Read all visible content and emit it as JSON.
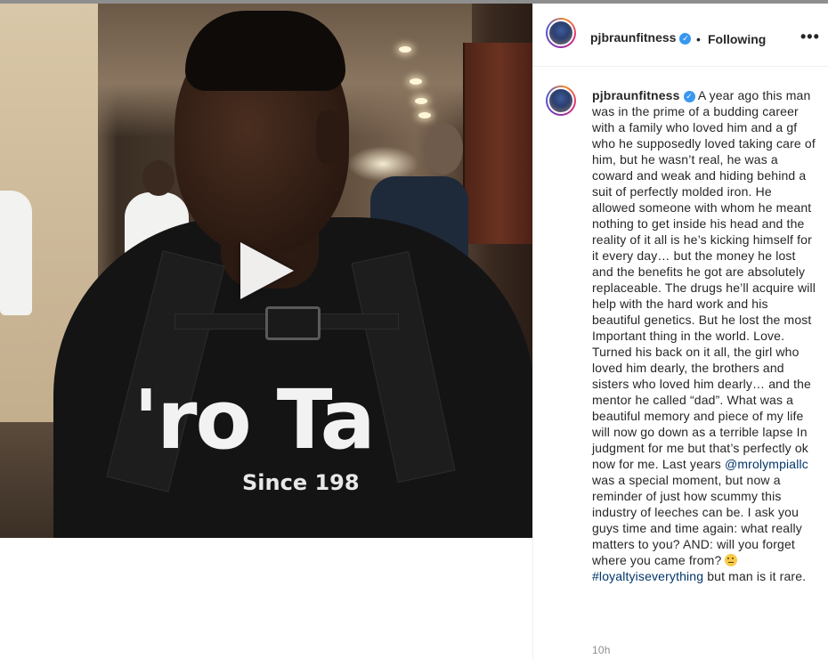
{
  "post": {
    "username": "pjbraunfitness",
    "verified": true,
    "follow_separator": "•",
    "follow_status": "Following",
    "more_options": "•••",
    "timestamp": "10h"
  },
  "caption": {
    "username": "pjbraunfitness",
    "text_1": "A year ago this man was in the prime of a budding career with a family who loved him and a gf who he supposedly loved taking care of him, but he wasn’t real, he was a coward and weak and hiding behind a suit of perfectly molded iron. He allowed someone with whom he meant nothing to get inside his head and the reality of it all is he’s kicking himself for it every day… but the money he lost and the benefits he got are absolutely replaceable. The drugs he’ll acquire will help with the hard work and his beautiful genetics. But he lost the most Important thing in the world. Love. Turned his back on it all, the girl who loved him dearly, the brothers and sisters who loved him dearly… and the mentor he called “dad”. What was a beautiful memory and piece of my life will now go down as a terrible lapse In judgment for me but that’s perfectly ok now for me. Last years ",
    "mention": "@mrolympiallc",
    "text_2": " was a special moment, but now a reminder of just how scummy this industry of leeches can be. I ask you guys time and time again: what really matters to you? AND: will you forget where you came from? ",
    "emoji": "thinking-face",
    "hashtag": "#loyaltyiseverything",
    "text_3": " but man is it rare."
  },
  "media": {
    "type": "video",
    "shirt_text": "'ro Tai",
    "shirt_subtext": "Since 198"
  }
}
